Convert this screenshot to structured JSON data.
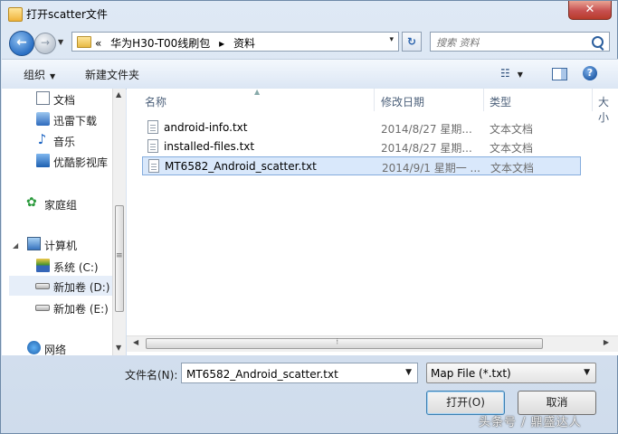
{
  "window": {
    "title": "打开scatter文件",
    "close_glyph": "✕"
  },
  "address": {
    "chevrons": "«",
    "path": [
      "华为H30-T00线刷包",
      "▸",
      "资料"
    ],
    "dropdown": "▾",
    "refresh": "↻"
  },
  "search": {
    "placeholder": "搜索 资料"
  },
  "toolbar": {
    "organize": "组织",
    "organize_arrow": "▼",
    "new_folder": "新建文件夹",
    "views_glyph": "☷",
    "views_arrow": "▼",
    "help": "?"
  },
  "nav": {
    "items": [
      {
        "label": "文档"
      },
      {
        "label": "迅雷下载"
      },
      {
        "label": "音乐"
      },
      {
        "label": "优酷影视库"
      },
      {
        "label": "家庭组"
      },
      {
        "label": "计算机"
      },
      {
        "label": "系统 (C:)"
      },
      {
        "label": "新加卷 (D:)"
      },
      {
        "label": "新加卷 (E:)"
      },
      {
        "label": "网络"
      }
    ]
  },
  "columns": {
    "name": "名称",
    "date": "修改日期",
    "type": "类型",
    "size": "大小"
  },
  "files": [
    {
      "name": "android-info.txt",
      "date": "2014/8/27 星期...",
      "type": "文本文档"
    },
    {
      "name": "installed-files.txt",
      "date": "2014/8/27 星期...",
      "type": "文本文档"
    },
    {
      "name": "MT6582_Android_scatter.txt",
      "date": "2014/9/1 星期一 ...",
      "type": "文本文档"
    }
  ],
  "bottom": {
    "filename_label": "文件名(N):",
    "filename_value": "MT6582_Android_scatter.txt",
    "filetype": "Map File (*.txt)",
    "open_button": "打开(O)",
    "cancel_button": "取消"
  },
  "watermark": "头条号 / 鼎盛达人"
}
